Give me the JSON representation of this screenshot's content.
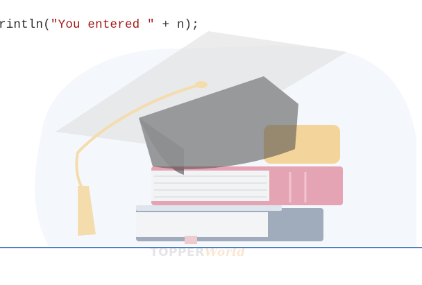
{
  "code": {
    "prefix": "rintln(",
    "string": "\"You entered \"",
    "concat": " + n);"
  },
  "watermark": {
    "icon": "graduation-cap-on-books-icon",
    "brand_part1": "TOPPER",
    "brand_part2": "World"
  },
  "colors": {
    "divider": "#4f7fc4",
    "string_literal": "#a31515",
    "blob_background": "#f3f8fd"
  }
}
